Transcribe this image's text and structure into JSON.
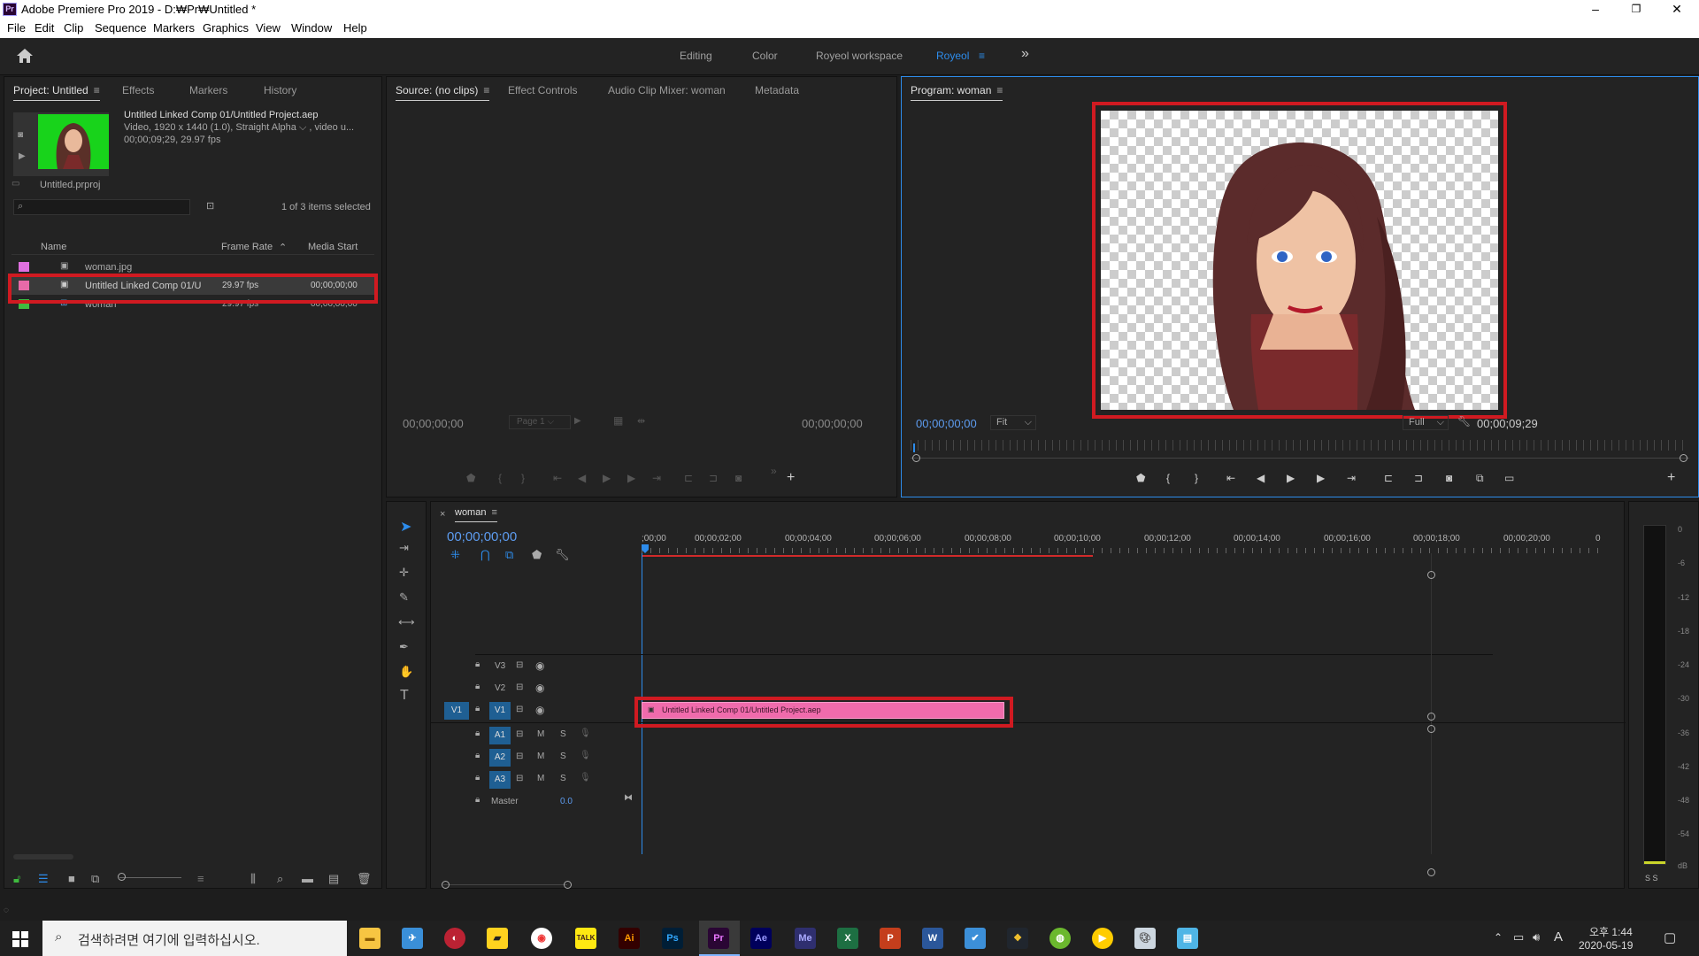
{
  "window": {
    "title": "Adobe Premiere Pro 2019 - D:₩Pr₩Untitled *",
    "logo": "Pr",
    "min": "–",
    "max": "❐",
    "close": "✕"
  },
  "menu": [
    "File",
    "Edit",
    "Clip",
    "Sequence",
    "Markers",
    "Graphics",
    "View",
    "Window",
    "Help"
  ],
  "workspaces": {
    "items": [
      "Editing",
      "Color",
      "Royeol workspace",
      "Royeol"
    ],
    "active": "Royeol",
    "overflow": "»"
  },
  "project": {
    "tabs": [
      "Project: Untitled",
      "Effects",
      "Markers",
      "History"
    ],
    "clip_name": "Untitled Linked Comp 01/Untitled Project.aep",
    "clip_info1": "Video, 1920 x 1440 (1.0), Straight Alpha",
    "clip_info1b": ", video u...",
    "clip_info2": "00;00;09;29, 29.97 fps",
    "file": "Untitled.prproj",
    "search_placeholder": "",
    "selection": "1 of 3 items selected",
    "columns": [
      "Name",
      "Frame Rate",
      "Media Start"
    ],
    "rows": [
      {
        "name": "woman.jpg",
        "rate": "",
        "start": "",
        "color": "#e070e0"
      },
      {
        "name": "Untitled Linked Comp 01/U",
        "rate": "29.97 fps",
        "start": "00;00;00;00",
        "color": "#e86aa8"
      },
      {
        "name": "woman",
        "rate": "29.97 fps",
        "start": "00;00;00;00",
        "color": "#3fbb3f"
      }
    ]
  },
  "source": {
    "tabs": [
      "Source: (no clips)",
      "Effect Controls",
      "Audio Clip Mixer: woman",
      "Metadata"
    ],
    "tc_left": "00;00;00;00",
    "tc_right": "00;00;00;00",
    "page": "Page 1"
  },
  "program": {
    "tab": "Program: woman",
    "tc": "00;00;00;00",
    "fit": "Fit",
    "full": "Full",
    "duration": "00;00;09;29"
  },
  "timeline": {
    "seq": "woman",
    "tc": "00;00;00;00",
    "ruler": [
      ";00;00",
      "00;00;02;00",
      "00;00;04;00",
      "00;00;06;00",
      "00;00;08;00",
      "00;00;10;00",
      "00;00;12;00",
      "00;00;14;00",
      "00;00;16;00",
      "00;00;18;00",
      "00;00;20;00",
      "0"
    ],
    "video_tracks": [
      "V3",
      "V2",
      "V1"
    ],
    "audio_tracks": [
      "A1",
      "A2",
      "A3"
    ],
    "src_patch": "V1",
    "master": "Master",
    "master_val": "0.0",
    "clip": "Untitled Linked Comp 01/Untitled Project.aep",
    "mute": "M",
    "solo": "S"
  },
  "meter": {
    "labels": [
      "0",
      "-6",
      "-12",
      "-18",
      "-24",
      "-30",
      "-36",
      "-42",
      "-48",
      "-54",
      "dB"
    ],
    "ss": "S S"
  },
  "taskbar": {
    "search": "검색하려면 여기에 입력하십시오.",
    "time": "오후 1:44",
    "date": "2020-05-19",
    "ime": "A"
  },
  "colors": {
    "accent": "#2d8ceb",
    "clip": "#f06bac",
    "highlight": "#d01a21",
    "timecode": "#5d9cf0",
    "green_screen": "#18d31b"
  }
}
